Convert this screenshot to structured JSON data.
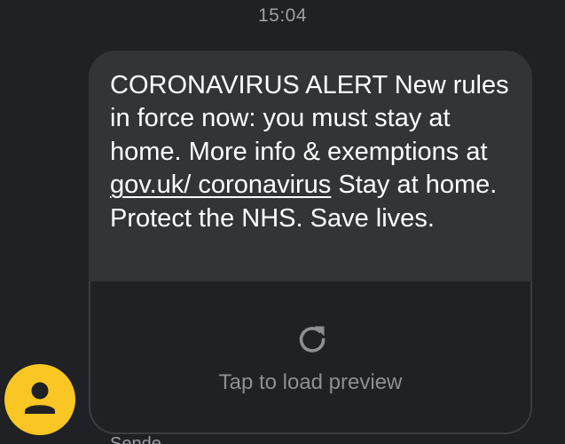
{
  "conversation": {
    "timestamp": "15:04"
  },
  "message": {
    "text_before_link": "CORONAVIRUS ALERT New rules in force now: you must stay at home. More info & exemptions at ",
    "link_text": "gov.uk/ coronavirus",
    "text_after_link": " Stay at home. Protect the NHS. Save lives."
  },
  "link_preview": {
    "icon": "reload-icon",
    "label": "Tap to load preview"
  },
  "sender": {
    "avatar_icon": "person-icon",
    "avatar_color": "#f9c623",
    "label_partial": "Sende"
  },
  "colors": {
    "background": "#202124",
    "bubble": "#333436",
    "text": "#ffffff",
    "muted": "#9aa0a6"
  }
}
